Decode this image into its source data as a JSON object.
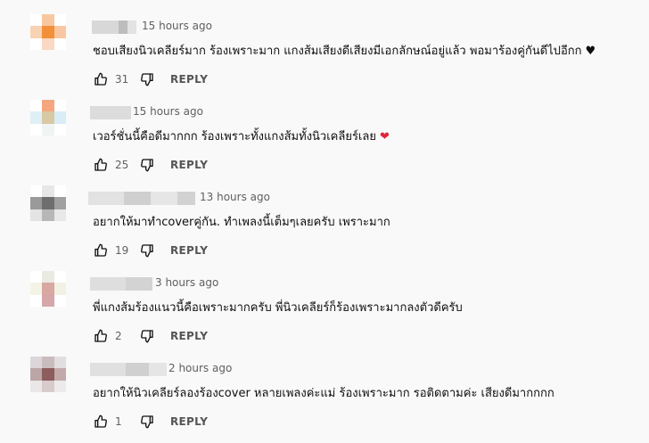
{
  "comments": [
    {
      "time": "15 hours ago",
      "text": "ชอบเสียงนิวเคลียร์มาก ร้องเพราะมาก แกงส้มเสียงดีเสียงมีเอกลักษณ์อยู่แล้ว พอมาร้องคู่กันดีไปอีกก",
      "emoji": "♥",
      "emoji_color": "#0f0f0f",
      "likes": "31",
      "reply": "REPLY",
      "avatar_colors": [
        "#ffffff",
        "#f7c8a0",
        "#ffffff",
        "#f8d2b4",
        "#f29039",
        "#f8c7a2",
        "#ffffff",
        "#f9d9c2",
        "#ffffff"
      ]
    },
    {
      "time": "15 hours ago",
      "text": "เวอร์ชั่นนี้คือดีมากกก ร้องเพราะทั้งแกงส้มทั้งนิวเคลียร์เลย",
      "emoji": "❤",
      "emoji_color": "#e0263a",
      "likes": "25",
      "reply": "REPLY",
      "avatar_colors": [
        "#ffffff",
        "#f4a77f",
        "#ffffff",
        "#dff0f5",
        "#d8c8a4",
        "#d9edf6",
        "#ffffff",
        "#f0f4f4",
        "#ffffff"
      ]
    },
    {
      "time": "13 hours ago",
      "text": "อยากให้มาทำcoverคู่กัน. ทำเพลงนี้เต็มๆเลยครับ เพราะมาก",
      "emoji": "",
      "emoji_color": "#0f0f0f",
      "likes": "19",
      "reply": "REPLY",
      "avatar_colors": [
        "#ffffff",
        "#e7e7e7",
        "#ffffff",
        "#9a9a9a",
        "#6e6e6e",
        "#a0a0a0",
        "#e4e4e4",
        "#b7b7b7",
        "#e8e8e8"
      ]
    },
    {
      "time": "3 hours ago",
      "text": "พี่แกงส้มร้องแนวนี้คือเพราะมากครับ พี่นิวเคลียร์ก็ร้องเพราะมากลงตัวดีครับ",
      "emoji": "",
      "emoji_color": "#0f0f0f",
      "likes": "2",
      "reply": "REPLY",
      "avatar_colors": [
        "#ffffff",
        "#eaeae2",
        "#ffffff",
        "#f4f4e6",
        "#d9a8a2",
        "#f3f1e4",
        "#ffffff",
        "#d6a7a8",
        "#ffffff"
      ]
    },
    {
      "time": "2 hours ago",
      "text": "อยากให้นิวเคลียร์ลองร้องcover หลายเพลงค่ะแม่ ร้องเพราะมาก รอติดตามค่ะ เสียงดีมากกกก",
      "emoji": "",
      "emoji_color": "#0f0f0f",
      "likes": "1",
      "reply": "REPLY",
      "avatar_colors": [
        "#dcd6da",
        "#c9bcbd",
        "#e2dee0",
        "#bca5a6",
        "#8d5c5d",
        "#c3a9aa",
        "#ebe6e8",
        "#d8cbcc",
        "#eeeaec"
      ]
    }
  ]
}
